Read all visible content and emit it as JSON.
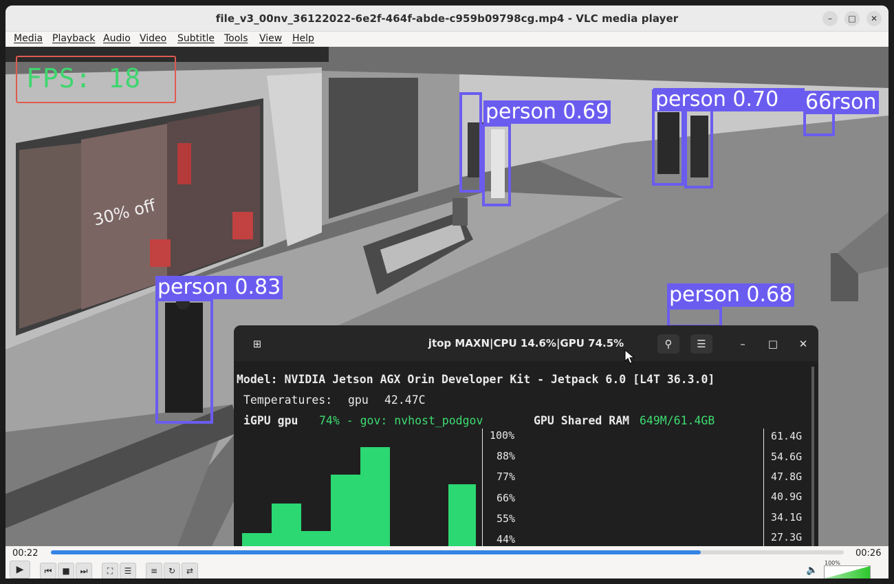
{
  "window": {
    "title": "file_v3_00nv_36122022-6e2f-464f-abde-c959b09798cg.mp4 - VLC media player",
    "minimize_icon": "minimize-icon",
    "maximize_icon": "maximize-icon",
    "close_icon": "close-icon"
  },
  "menu": [
    "Media",
    "Playback",
    "Audio",
    "Video",
    "Subtitle",
    "Tools",
    "View",
    "Help"
  ],
  "video": {
    "fps_label": "FPS: 18",
    "detections": [
      {
        "label": "person 0.69",
        "class": "person",
        "confidence": 0.69
      },
      {
        "label": "person 0.70",
        "class": "person",
        "confidence": 0.7
      },
      {
        "label": "66rson",
        "class": "person",
        "confidence": 0.66
      },
      {
        "label": "person 0.83",
        "class": "person",
        "confidence": 0.83
      },
      {
        "label": "person 0.68",
        "class": "person",
        "confidence": 0.68
      }
    ],
    "storefront_text": "30% off",
    "jtop": {
      "title": "jtop MAXN|CPU 14.6%|GPU 74.5%",
      "model_line": "Model: NVIDIA Jetson AGX Orin Developer Kit - Jetpack 6.0 [L4T 36.3.0]",
      "temp_label": "Temperatures:",
      "temp_sensor": "gpu",
      "temp_value": "42.47C",
      "igpu_label": "iGPU gpu",
      "igpu_value": "74% - gov: nvhost_podgov",
      "ram_label": "GPU Shared RAM",
      "ram_value": "649M/61.4GB",
      "gpu_ticks": [
        "100%",
        "88%",
        "77%",
        "66%",
        "55%",
        "44%"
      ],
      "ram_ticks": [
        "61.4G",
        "54.6G",
        "47.8G",
        "40.9G",
        "34.1G",
        "27.3G"
      ],
      "gpu_history_percent": [
        42,
        60,
        43,
        78,
        95,
        38,
        72
      ]
    }
  },
  "playback": {
    "elapsed": "00:22",
    "duration": "00:26",
    "progress": 0.82,
    "volume_label": "100%",
    "volume": 1.0
  }
}
